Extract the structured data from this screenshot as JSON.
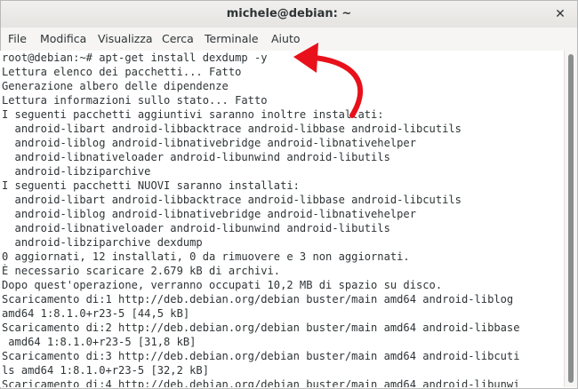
{
  "window": {
    "title": "michele@debian: ~",
    "close_glyph": "✕"
  },
  "menubar": {
    "items": [
      {
        "label": "File"
      },
      {
        "label": "Modifica"
      },
      {
        "label": "Visualizza"
      },
      {
        "label": "Cerca"
      },
      {
        "label": "Terminale"
      },
      {
        "label": "Aiuto"
      }
    ]
  },
  "terminal": {
    "prompt": "root@debian:~# ",
    "command": "apt-get install dexdump -y",
    "output": [
      "Lettura elenco dei pacchetti... Fatto",
      "Generazione albero delle dipendenze",
      "Lettura informazioni sullo stato... Fatto",
      "I seguenti pacchetti aggiuntivi saranno inoltre installati:",
      "  android-libart android-libbacktrace android-libbase android-libcutils",
      "  android-liblog android-libnativebridge android-libnativehelper",
      "  android-libnativeloader android-libunwind android-libutils",
      "  android-libziparchive",
      "I seguenti pacchetti NUOVI saranno installati:",
      "  android-libart android-libbacktrace android-libbase android-libcutils",
      "  android-liblog android-libnativebridge android-libnativehelper",
      "  android-libnativeloader android-libunwind android-libutils",
      "  android-libziparchive dexdump",
      "0 aggiornati, 12 installati, 0 da rimuovere e 3 non aggiornati.",
      "È necessario scaricare 2.679 kB di archivi.",
      "Dopo quest'operazione, verranno occupati 10,2 MB di spazio su disco.",
      "Scaricamento di:1 http://deb.debian.org/debian buster/main amd64 android-liblog",
      "amd64 1:8.1.0+r23-5 [44,5 kB]",
      "Scaricamento di:2 http://deb.debian.org/debian buster/main amd64 android-libbase",
      " amd64 1:8.1.0+r23-5 [31,8 kB]",
      "Scaricamento di:3 http://deb.debian.org/debian buster/main amd64 android-libcuti",
      "ls amd64 1:8.1.0+r23-5 [32,2 kB]",
      "Scaricamento di:4 http://deb.debian.org/debian buster/main amd64 android-libunwi"
    ]
  },
  "annotation": {
    "color": "#e8101a"
  }
}
